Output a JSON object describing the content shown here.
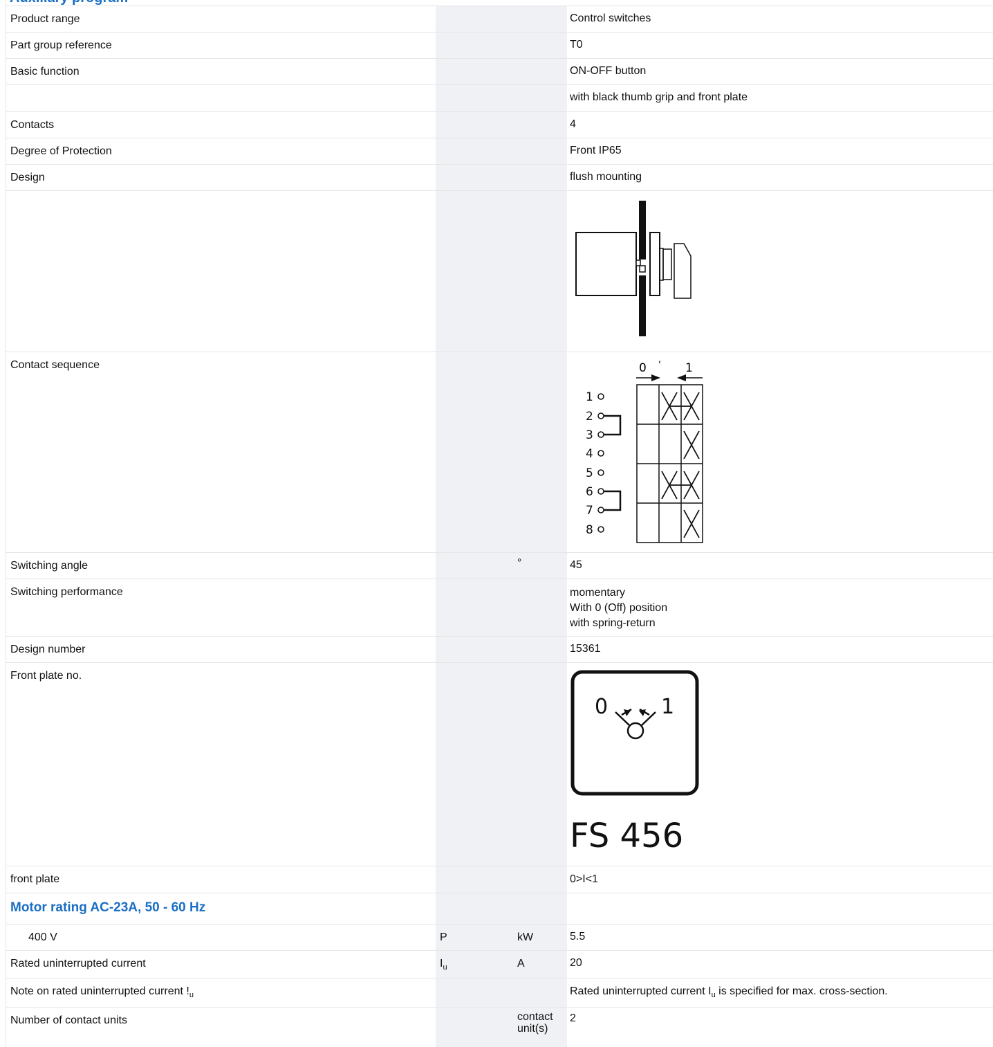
{
  "section_top": "Auxiliary program",
  "rows": {
    "product_range": {
      "label": "Product range",
      "value": "Control switches"
    },
    "part_group": {
      "label": "Part group reference",
      "value": "T0"
    },
    "basic_function": {
      "label": "Basic function",
      "value": "ON-OFF button"
    },
    "basic_function_extra": {
      "value": "with black thumb grip and front plate"
    },
    "contacts": {
      "label": "Contacts",
      "value": "4"
    },
    "protection": {
      "label": "Degree of Protection",
      "value": "Front IP65"
    },
    "design": {
      "label": "Design",
      "value": "flush mounting"
    },
    "contact_sequence": {
      "label": "Contact sequence"
    },
    "switching_angle": {
      "label": "Switching angle",
      "unit": "°",
      "value": "45"
    },
    "switching_performance": {
      "label": "Switching performance",
      "value_lines": [
        "momentary",
        "With 0 (Off) position",
        "with spring-return"
      ]
    },
    "design_number": {
      "label": "Design number",
      "value": "15361"
    },
    "front_plate_no": {
      "label": "Front plate no.",
      "plate_code": "FS 456"
    },
    "front_plate": {
      "label": "front plate",
      "value": "0>I<1"
    },
    "motor_heading": "Motor rating AC-23A, 50 - 60 Hz",
    "motor_400": {
      "label": "400 V",
      "symbol": "P",
      "unit": "kW",
      "value": "5.5"
    },
    "rated_current": {
      "label": "Rated uninterrupted current",
      "symbol": "I",
      "symbol_sub": "u",
      "unit": "A",
      "value": "20"
    },
    "note_current": {
      "label": "Note on rated uninterrupted current !",
      "label_sub": "u",
      "value_a": "Rated uninterrupted current I",
      "value_sub": "u",
      "value_b": " is specified for max. cross-section."
    },
    "contact_units": {
      "label": "Number of contact units",
      "unit_lines": [
        "contact",
        "unit(s)"
      ],
      "value": "2"
    }
  },
  "diagram": {
    "positions": [
      "0",
      "1"
    ],
    "contacts": [
      "1",
      "2",
      "3",
      "4",
      "5",
      "6",
      "7",
      "8"
    ],
    "plate_left": "0",
    "plate_right": "1"
  }
}
